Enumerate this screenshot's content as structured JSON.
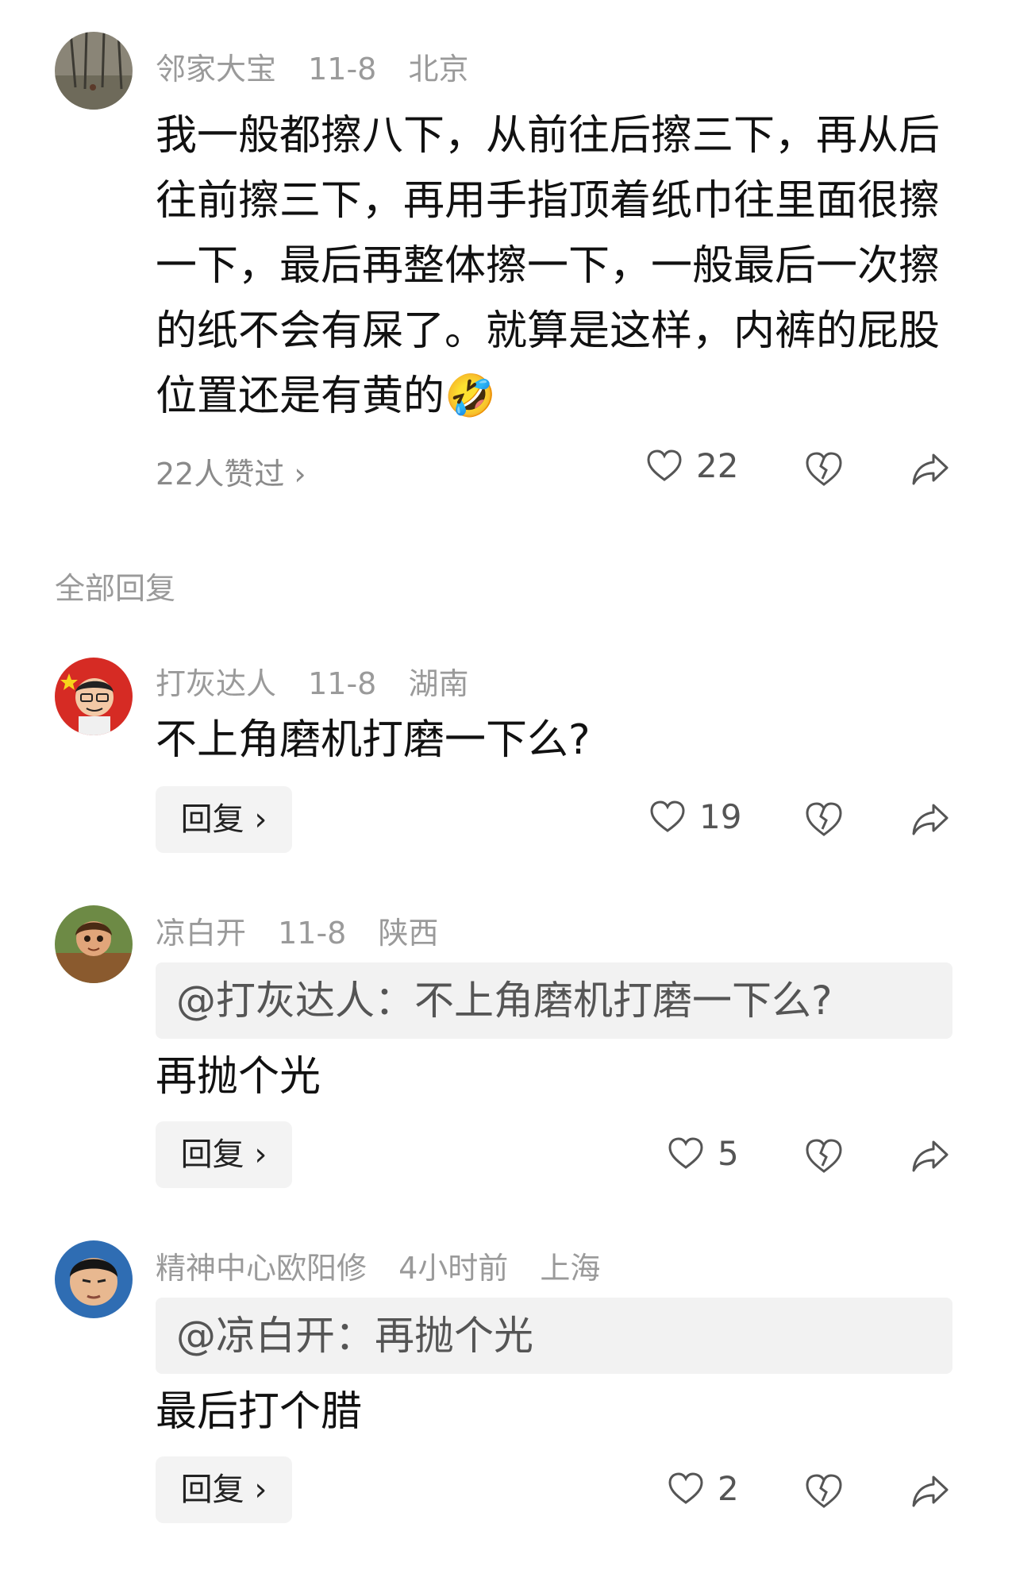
{
  "main_comment": {
    "author": "邻家大宝",
    "date": "11-8",
    "location": "北京",
    "text": "我一般都擦八下，从前往后擦三下，再从后往前擦三下，再用手指顶着纸巾往里面很擦一下，最后再整体擦一下，一般最后一次擦的纸不会有屎了。就算是这样，内裤的屁股位置还是有黄的🤣",
    "liked_by": "22人赞过 ›",
    "likes": "22"
  },
  "section_title": "全部回复",
  "replies": [
    {
      "author": "打灰达人",
      "date": "11-8",
      "location": "湖南",
      "quote": "",
      "text": "不上角磨机打磨一下么?",
      "reply_label": "回复 ›",
      "likes": "19"
    },
    {
      "author": "凉白开",
      "date": "11-8",
      "location": "陕西",
      "quote": "@打灰达人：不上角磨机打磨一下么?",
      "text": "再抛个光",
      "reply_label": "回复 ›",
      "likes": "5"
    },
    {
      "author": "精神中心欧阳修",
      "date": "4小时前",
      "location": "上海",
      "quote": "@凉白开：再抛个光",
      "text": "最后打个腊",
      "reply_label": "回复 ›",
      "likes": "2"
    }
  ],
  "icons": {
    "like": "heart-outline-icon",
    "dislike": "broken-heart-icon",
    "share": "share-arrow-icon"
  },
  "colors": {
    "meta_gray": "#9a9a9a",
    "reply_bg": "#f3f3f3",
    "quote_bg": "#f2f2f2"
  }
}
